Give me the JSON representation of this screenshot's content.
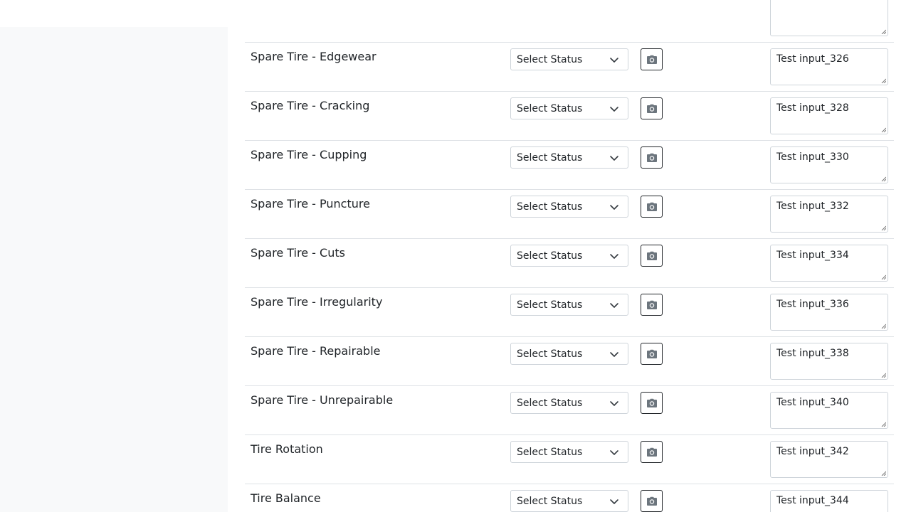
{
  "rows": [
    {
      "label": "Spare Tire - Edgewear",
      "status": "Select Status",
      "notes": "Test input_326"
    },
    {
      "label": "Spare Tire - Cracking",
      "status": "Select Status",
      "notes": "Test input_328"
    },
    {
      "label": "Spare Tire - Cupping",
      "status": "Select Status",
      "notes": "Test input_330"
    },
    {
      "label": "Spare Tire - Puncture",
      "status": "Select Status",
      "notes": "Test input_332"
    },
    {
      "label": "Spare Tire - Cuts",
      "status": "Select Status",
      "notes": "Test input_334"
    },
    {
      "label": "Spare Tire - Irregularity",
      "status": "Select Status",
      "notes": "Test input_336"
    },
    {
      "label": "Spare Tire - Repairable",
      "status": "Select Status",
      "notes": "Test input_338"
    },
    {
      "label": "Spare Tire - Unrepairable",
      "status": "Select Status",
      "notes": "Test input_340"
    },
    {
      "label": "Tire Rotation",
      "status": "Select Status",
      "notes": "Test input_342"
    },
    {
      "label": "Tire Balance",
      "status": "Select Status",
      "notes": "Test input_344"
    }
  ],
  "icons": {
    "camera": "camera-icon",
    "dropdown": "chevron-down-icon"
  },
  "colors": {
    "sidebar_bg": "#f8f9fa",
    "border": "#dee2e6",
    "icon": "#6c757d"
  }
}
